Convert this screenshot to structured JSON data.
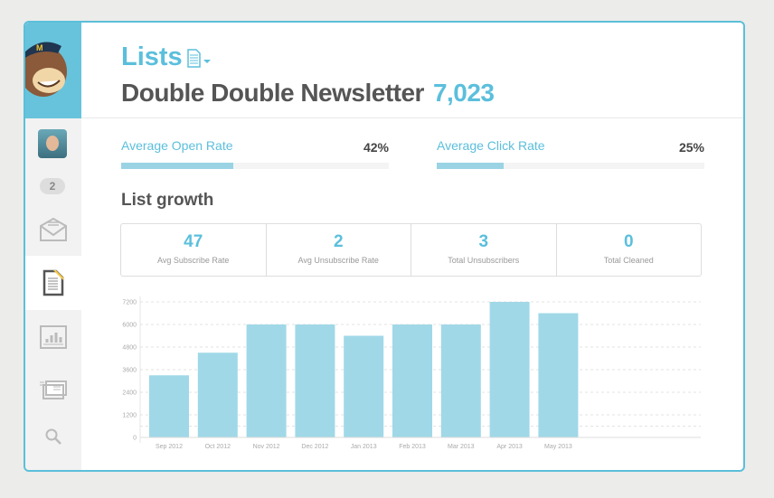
{
  "header": {
    "section": "Lists",
    "list_name": "Double Double Newsletter",
    "subscriber_count": "7,023"
  },
  "sidebar": {
    "badge": "2",
    "items": [
      {
        "icon": "campaigns-icon"
      },
      {
        "icon": "lists-icon",
        "active": true
      },
      {
        "icon": "reports-icon"
      },
      {
        "icon": "templates-icon"
      },
      {
        "icon": "search-icon"
      }
    ]
  },
  "rates": [
    {
      "label": "Average Open Rate",
      "value": "42%",
      "percent": 42
    },
    {
      "label": "Average Click Rate",
      "value": "25%",
      "percent": 25
    }
  ],
  "list_growth": {
    "heading": "List growth",
    "stats": [
      {
        "value": "47",
        "label": "Avg Subscribe Rate"
      },
      {
        "value": "2",
        "label": "Avg Unsubscribe Rate"
      },
      {
        "value": "3",
        "label": "Total Unsubscribers"
      },
      {
        "value": "0",
        "label": "Total Cleaned"
      }
    ]
  },
  "colors": {
    "accent": "#5bbfdc",
    "bar": "#a0d8e7"
  },
  "chart_data": {
    "type": "bar",
    "categories": [
      "Sep 2012",
      "Oct 2012",
      "Nov 2012",
      "Dec 2012",
      "Jan 2013",
      "Feb 2013",
      "Mar 2013",
      "Apr 2013",
      "May 2013"
    ],
    "values": [
      3300,
      4500,
      6000,
      6000,
      5400,
      6000,
      6000,
      7200,
      6600
    ],
    "yticks": [
      0,
      1200,
      2400,
      3600,
      4800,
      6000,
      7200
    ],
    "ylim": [
      0,
      7200
    ],
    "grid": true
  }
}
